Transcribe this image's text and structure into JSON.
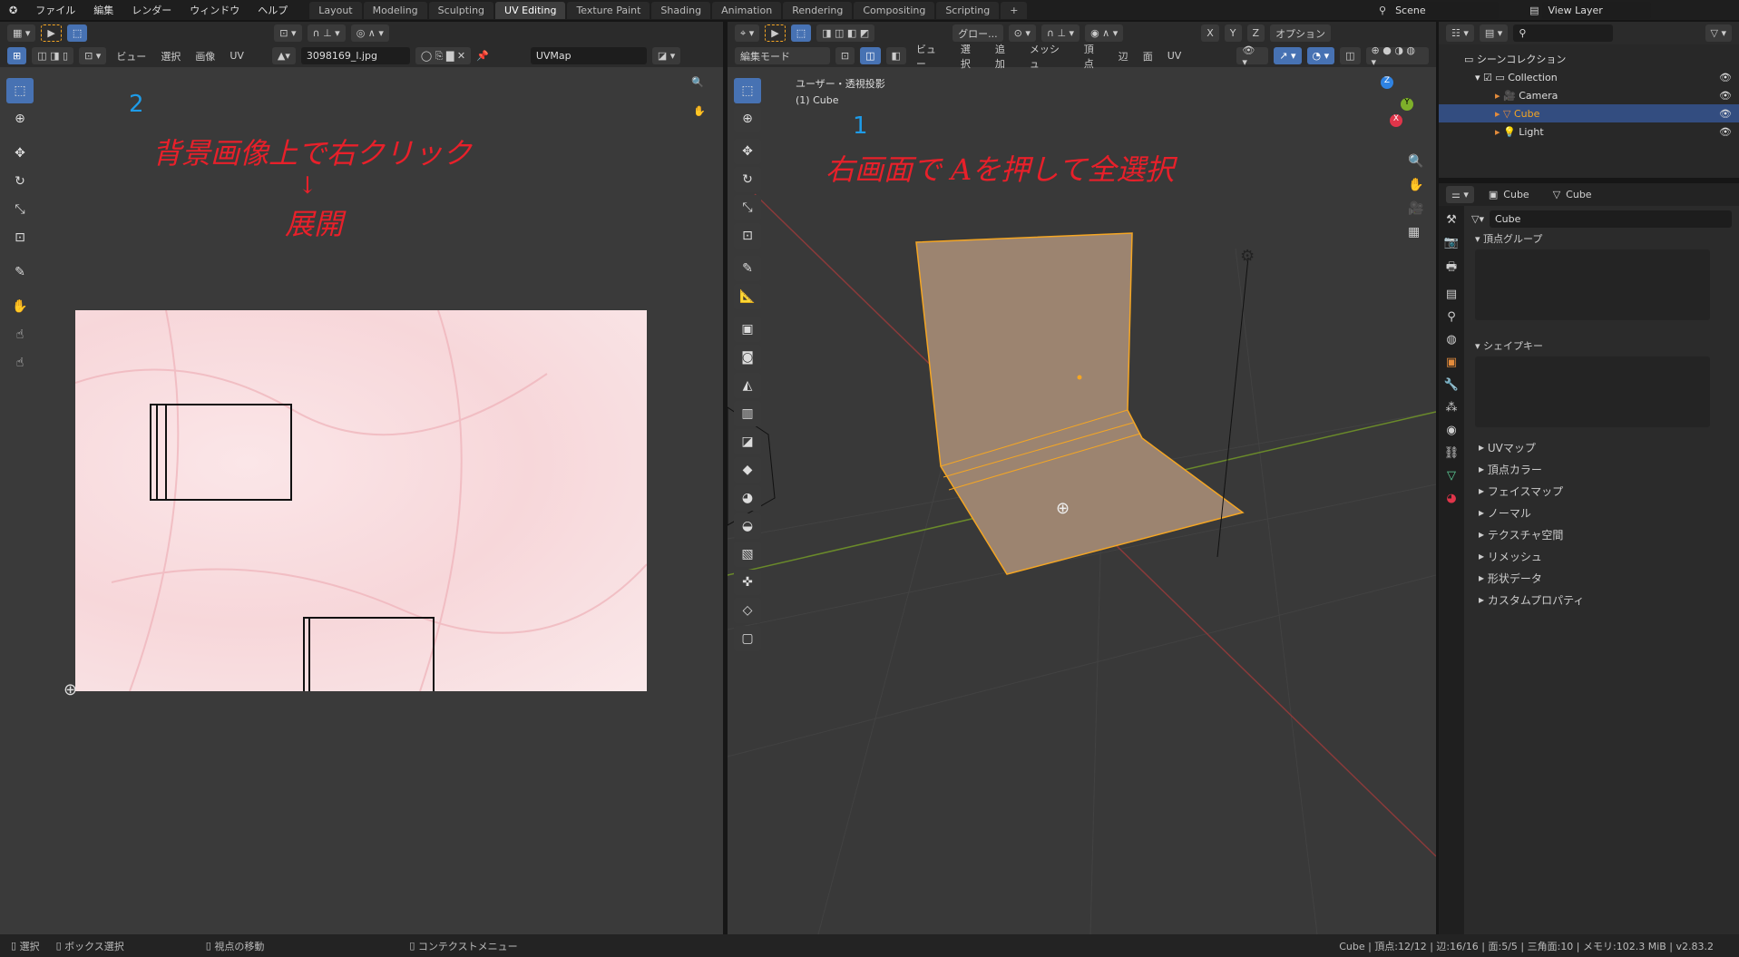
{
  "topbar": {
    "menus": [
      "ファイル",
      "編集",
      "レンダー",
      "ウィンドウ",
      "ヘルプ"
    ],
    "tabs": [
      "Layout",
      "Modeling",
      "Sculpting",
      "UV Editing",
      "Texture Paint",
      "Shading",
      "Animation",
      "Rendering",
      "Compositing",
      "Scripting"
    ],
    "active_tab": "UV Editing",
    "scene": "Scene",
    "view_layer": "View Layer"
  },
  "uv_editor": {
    "menus": [
      "ビュー",
      "選択",
      "画像",
      "UV"
    ],
    "image_name": "3098169_l.jpg",
    "uv_map": "UVMap",
    "annotation_number": "2",
    "annotation_line1": "背景画像上で右クリック",
    "annotation_arrow": "↓",
    "annotation_line2": "展開"
  },
  "viewport": {
    "mode": "編集モード",
    "menus": [
      "ビュー",
      "選択",
      "追加",
      "メッシュ",
      "頂点",
      "辺",
      "面",
      "UV"
    ],
    "transform": "グロー...",
    "axes": [
      "X",
      "Y",
      "Z"
    ],
    "options": "オプション",
    "view_name": "ユーザー・透視投影",
    "object_label": "(1) Cube",
    "annotation_number": "1",
    "annotation_text": "右画面で Aを押して全選択"
  },
  "outliner": {
    "scene_collection": "シーンコレクション",
    "items": [
      {
        "name": "Collection"
      },
      {
        "name": "Camera"
      },
      {
        "name": "Cube",
        "selected": true
      },
      {
        "name": "Light"
      }
    ]
  },
  "properties": {
    "object": "Cube",
    "data": "Cube",
    "mesh_name": "Cube",
    "panels_open": [
      "頂点グループ",
      "シェイプキー"
    ],
    "panels": [
      "UVマップ",
      "頂点カラー",
      "フェイスマップ",
      "ノーマル",
      "テクスチャ空間",
      "リメッシュ",
      "形状データ",
      "カスタムプロパティ"
    ]
  },
  "statusbar": {
    "select": "選択",
    "box_select": "ボックス選択",
    "move_view": "視点の移動",
    "context_menu": "コンテクストメニュー",
    "stats": "Cube | 頂点:12/12 | 辺:16/16 | 面:5/5 | 三角面:10 | メモリ:102.3 MiB | v2.83.2"
  },
  "colors": {
    "accent": "#4772b3",
    "selection": "#f5a623",
    "annotation_red": "#e8202a",
    "annotation_blue": "#1e9be8"
  }
}
